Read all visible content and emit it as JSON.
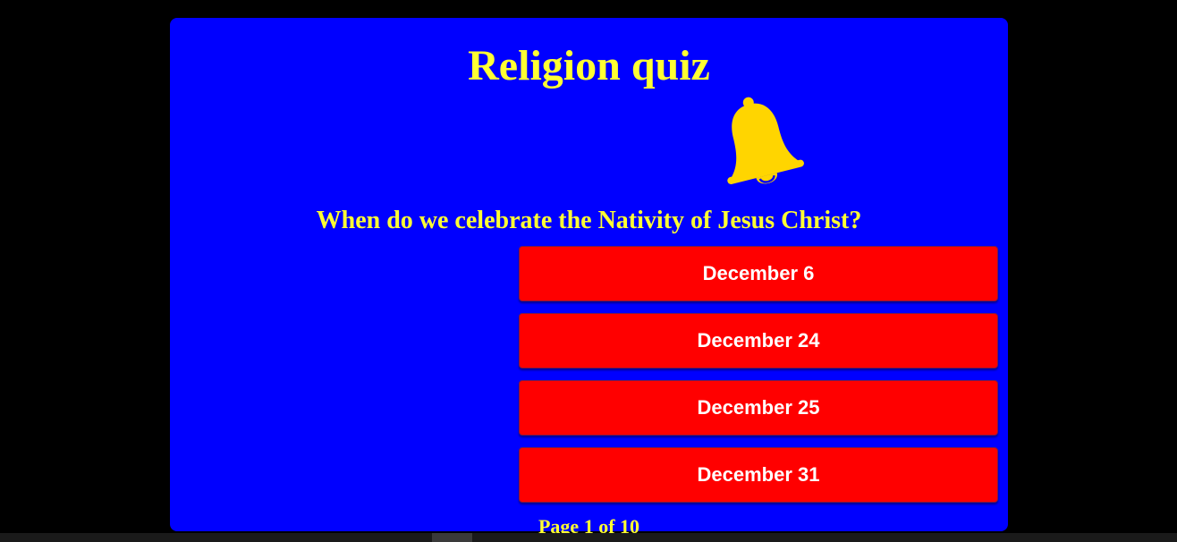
{
  "quiz": {
    "title": "Religion quiz",
    "icon": "bell-icon",
    "question": "When do we celebrate the Nativity of Jesus Christ?",
    "answers": [
      {
        "label": "December 6"
      },
      {
        "label": "December 24"
      },
      {
        "label": "December 25"
      },
      {
        "label": "December 31"
      }
    ],
    "page_indicator": "Page 1 of 10"
  },
  "colors": {
    "background": "#000000",
    "card": "#0000ff",
    "title_text": "#ffff33",
    "bell": "#ffd500",
    "answer_button": "#ff0000",
    "answer_text": "#ffffff"
  }
}
